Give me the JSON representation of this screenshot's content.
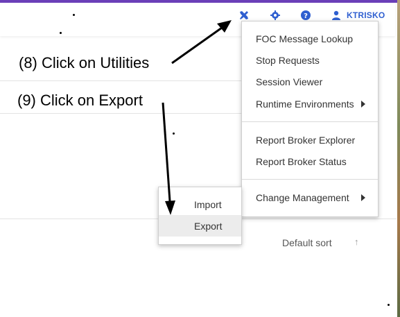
{
  "header": {
    "username": "KTRISKO",
    "icons": {
      "utilities": "wrench-screwdriver-icon",
      "settings": "gear-icon",
      "help": "question-circle-icon",
      "user": "user-icon"
    },
    "accent_color": "#6b3fb8",
    "link_color": "#2f5fd0"
  },
  "annotations": {
    "step8": "(8) Click on Utilities",
    "step9": "(9) Click on Export"
  },
  "utilities_menu": {
    "items": [
      {
        "label": "FOC Message Lookup"
      },
      {
        "label": "Stop Requests"
      },
      {
        "label": "Session Viewer"
      },
      {
        "label": "Runtime Environments",
        "submenu": true
      },
      {
        "label": "Report Broker Explorer"
      },
      {
        "label": "Report Broker Status"
      },
      {
        "label": "Change Management",
        "submenu": true
      }
    ]
  },
  "change_management_submenu": {
    "items": [
      {
        "label": "Import"
      },
      {
        "label": "Export",
        "highlighted": true
      }
    ]
  },
  "list_controls": {
    "sort_label": "Default sort",
    "sort_arrow": "↑",
    "collapse_chevron": "^"
  }
}
